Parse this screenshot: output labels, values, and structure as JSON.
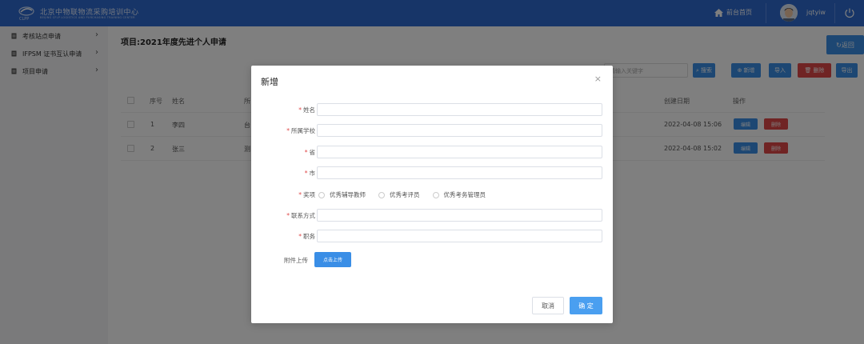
{
  "header": {
    "logo_text": "北京中物联物流采购培训中心",
    "logo_subtext": "BEIJING CFLP LOGISTICS AND PURCHASING TRAINING CENTER",
    "home_label": "前台首页",
    "username": "jqtyiw"
  },
  "sidebar": {
    "items": [
      {
        "label": "考核站点申请"
      },
      {
        "label": "IFPSM 证书互认申请"
      },
      {
        "label": "项目申请"
      }
    ]
  },
  "main": {
    "project_title": "项目:2021年度先进个人申请",
    "back_label": "返回",
    "search_placeholder": "请输入关键字",
    "toolbar": {
      "search": "搜索",
      "add": "新增",
      "import": "导入",
      "delete": "删除",
      "export": "导出"
    },
    "table": {
      "headers": {
        "index": "序号",
        "name": "姓名",
        "school": "所",
        "date": "创建日期",
        "actions": "操作"
      },
      "rows": [
        {
          "index": "1",
          "name": "李四",
          "school": "台",
          "date": "2022-04-08 15:06",
          "edit": "编辑",
          "delete": "删除"
        },
        {
          "index": "2",
          "name": "张三",
          "school": "测",
          "date": "2022-04-08 15:02",
          "edit": "编辑",
          "delete": "删除"
        }
      ]
    }
  },
  "modal": {
    "title": "新增",
    "fields": {
      "name": "姓名",
      "school": "所属学校",
      "province": "省",
      "city": "市",
      "award": "奖项",
      "contact": "联系方式",
      "position": "职务"
    },
    "award_options": [
      "优秀辅导教师",
      "优秀考评员",
      "优秀考务管理员"
    ],
    "upload_label": "附件上传",
    "upload_button": "点击上传",
    "cancel": "取消",
    "confirm": "确 定"
  },
  "colors": {
    "header_bg": "#2e6bd0",
    "primary": "#3a8ee6",
    "danger": "#e04848"
  }
}
